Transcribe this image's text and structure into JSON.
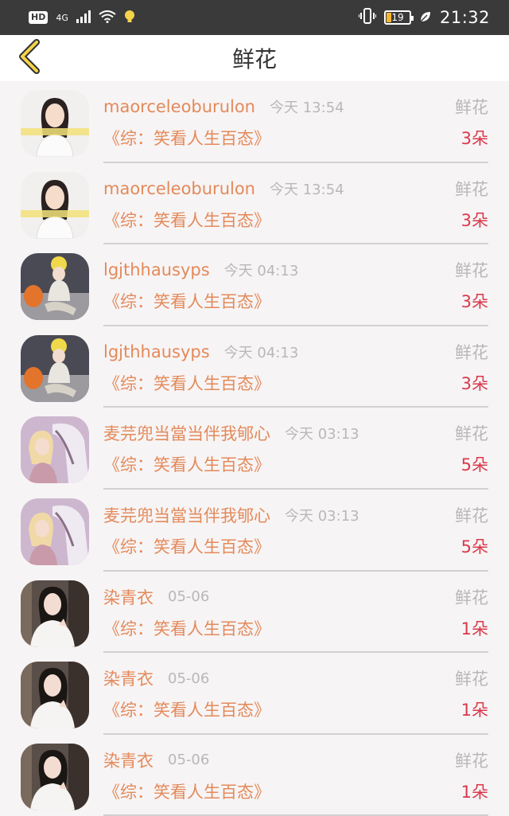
{
  "status_bar": {
    "hd_badge": "HD",
    "network": "4G",
    "battery_level": "19",
    "time": "21:32"
  },
  "nav": {
    "title": "鲜花"
  },
  "records": [
    {
      "name": "maorceleoburulon",
      "time": "今天 13:54",
      "kind": "鲜花",
      "book": "《综：笑看人生百态》",
      "count": "3朵",
      "avatar": "girl-white-top"
    },
    {
      "name": "maorceleoburulon",
      "time": "今天 13:54",
      "kind": "鲜花",
      "book": "《综：笑看人生百态》",
      "count": "3朵",
      "avatar": "girl-white-top"
    },
    {
      "name": "lgjthhausyps",
      "time": "今天 04:13",
      "kind": "鲜花",
      "book": "《综：笑看人生百态》",
      "count": "3朵",
      "avatar": "girl-sitting-orange-bag"
    },
    {
      "name": "lgjthhausyps",
      "time": "今天 04:13",
      "kind": "鲜花",
      "book": "《综：笑看人生百态》",
      "count": "3朵",
      "avatar": "girl-sitting-orange-bag"
    },
    {
      "name": "麦芫兜当當当伴我郇心",
      "time": "今天 03:13",
      "kind": "鲜花",
      "book": "《综：笑看人生百态》",
      "count": "5朵",
      "avatar": "girl-with-horse"
    },
    {
      "name": "麦芫兜当當当伴我郇心",
      "time": "今天 03:13",
      "kind": "鲜花",
      "book": "《综：笑看人生百态》",
      "count": "5朵",
      "avatar": "girl-with-horse"
    },
    {
      "name": "染青衣",
      "time": "05-06",
      "kind": "鲜花",
      "book": "《综：笑看人生百态》",
      "count": "1朵",
      "avatar": "girl-praying-white"
    },
    {
      "name": "染青衣",
      "time": "05-06",
      "kind": "鲜花",
      "book": "《综：笑看人生百态》",
      "count": "1朵",
      "avatar": "girl-praying-white"
    },
    {
      "name": "染青衣",
      "time": "05-06",
      "kind": "鲜花",
      "book": "《综：笑看人生百态》",
      "count": "1朵",
      "avatar": "girl-praying-white"
    }
  ]
}
